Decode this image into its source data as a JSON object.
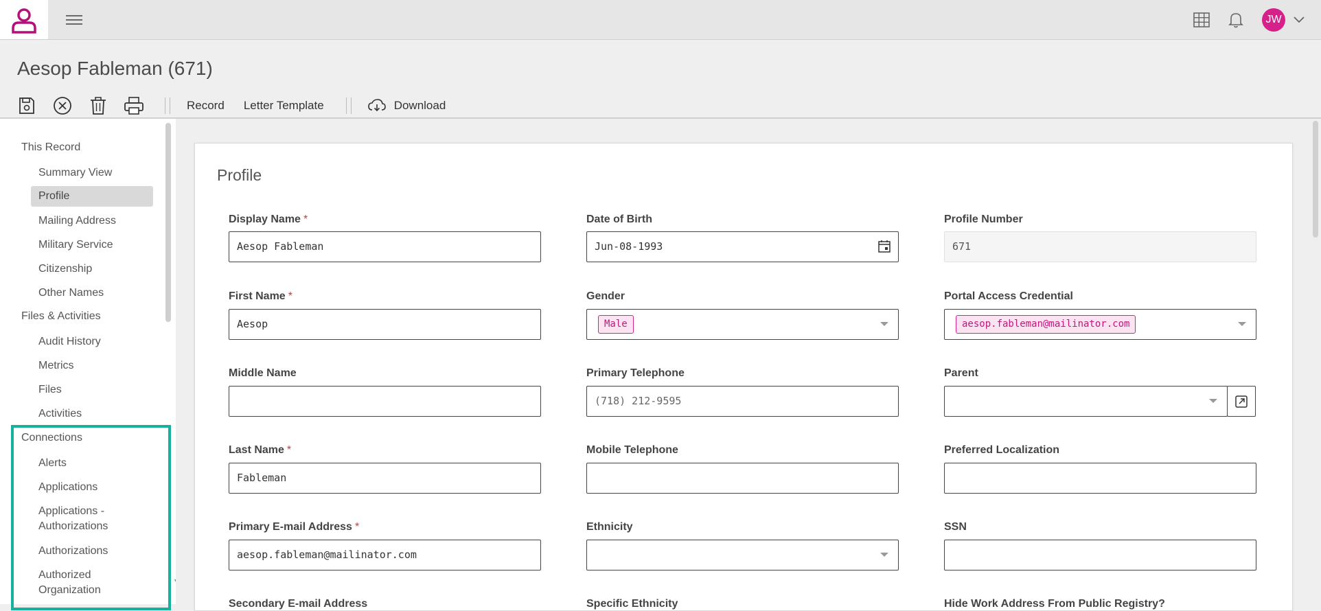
{
  "topbar": {
    "avatar_initials": "JW",
    "icons": [
      "person-logo-icon",
      "hamburger-icon",
      "grid-icon",
      "bell-icon",
      "chevron-down-icon"
    ],
    "brand_color": "#b5107a"
  },
  "header": {
    "title": "Aesop Fableman (671)"
  },
  "toolbar": {
    "icons": [
      "save-icon",
      "cancel-icon",
      "delete-icon",
      "print-icon",
      "download-icon"
    ],
    "record_label": "Record",
    "letter_template_label": "Letter Template",
    "download_label": "Download"
  },
  "sidebar": {
    "section1": {
      "title": "This Record",
      "items": [
        "Summary View",
        "Profile",
        "Mailing Address",
        "Military Service",
        "Citizenship",
        "Other Names"
      ],
      "active": "Profile"
    },
    "section2": {
      "title": "Files & Activities",
      "items": [
        "Audit History",
        "Metrics",
        "Files",
        "Activities"
      ]
    },
    "section3": {
      "title": "Connections",
      "items": [
        "Alerts",
        "Applications",
        "Applications -",
        "Authorizations",
        "Authorizations",
        "Authorized",
        "Organization"
      ]
    },
    "highlight_color": "#17b09b"
  },
  "form": {
    "title": "Profile",
    "required_marker": "*",
    "fields": {
      "display_name": {
        "label": "Display Name",
        "value": "Aesop Fableman"
      },
      "dob": {
        "label": "Date of Birth",
        "value": "Jun-08-1993"
      },
      "profile_number": {
        "label": "Profile Number",
        "value": "671"
      },
      "first_name": {
        "label": "First Name",
        "value": "Aesop"
      },
      "gender": {
        "label": "Gender",
        "value": "Male"
      },
      "portal": {
        "label": "Portal Access Credential",
        "value": "aesop.fableman@mailinator.com"
      },
      "middle_name": {
        "label": "Middle Name",
        "value": ""
      },
      "primary_phone": {
        "label": "Primary Telephone",
        "value": "(718) 212-9595"
      },
      "parent": {
        "label": "Parent",
        "value": ""
      },
      "last_name": {
        "label": "Last Name",
        "value": "Fableman"
      },
      "mobile_phone": {
        "label": "Mobile Telephone",
        "value": ""
      },
      "preferred_localization": {
        "label": "Preferred Localization",
        "value": ""
      },
      "primary_email": {
        "label": "Primary E-mail Address",
        "value": "aesop.fableman@mailinator.com"
      },
      "ethnicity": {
        "label": "Ethnicity",
        "value": ""
      },
      "ssn": {
        "label": "SSN",
        "value": ""
      }
    },
    "partial_labels": [
      "Secondary E-mail Address",
      "Specific Ethnicity",
      "Hide Work Address From Public Registry?"
    ]
  }
}
